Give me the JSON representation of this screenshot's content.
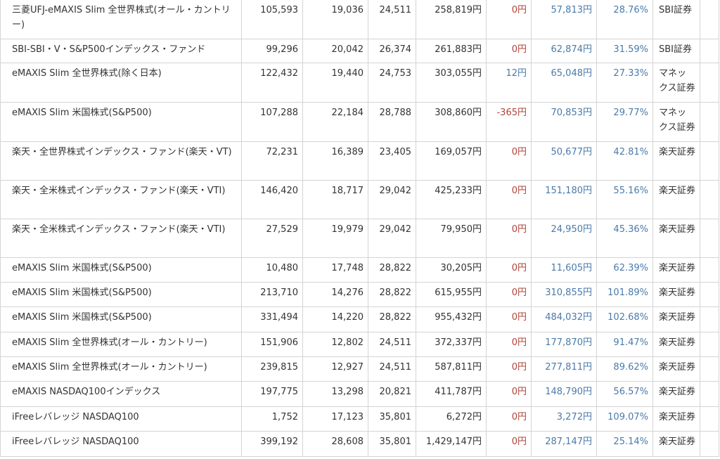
{
  "colors": {
    "zero_fee": "#b0443a",
    "positive_fee": "#4a7aaa",
    "gain": "#4a7aaa",
    "border": "#d4d4d4",
    "text": "#333333"
  },
  "rows": [
    {
      "name": "三菱UFJ-eMAXIS Slim 全世界株式(オール・カントリー)",
      "units": "105,593",
      "purchase_price": "19,036",
      "current_price": "24,511",
      "valuation": "258,819円",
      "fee": "0円",
      "fee_type": "zero",
      "gain": "57,813円",
      "rate": "28.76%",
      "broker": "SBI証券"
    },
    {
      "name": "SBI-SBI・V・S&P500インデックス・ファンド",
      "units": "99,296",
      "purchase_price": "20,042",
      "current_price": "26,374",
      "valuation": "261,883円",
      "fee": "0円",
      "fee_type": "zero",
      "gain": "62,874円",
      "rate": "31.59%",
      "broker": "SBI証券"
    },
    {
      "name": "eMAXIS Slim 全世界株式(除く日本)",
      "units": "122,432",
      "purchase_price": "19,440",
      "current_price": "24,753",
      "valuation": "303,055円",
      "fee": "12円",
      "fee_type": "pos",
      "gain": "65,048円",
      "rate": "27.33%",
      "broker": "マネックス証券"
    },
    {
      "name": "eMAXIS Slim 米国株式(S&P500)",
      "units": "107,288",
      "purchase_price": "22,184",
      "current_price": "28,788",
      "valuation": "308,860円",
      "fee": "-365円",
      "fee_type": "neg",
      "gain": "70,853円",
      "rate": "29.77%",
      "broker": "マネックス証券"
    },
    {
      "name": "楽天・全世界株式インデックス・ファンド(楽天・VT)",
      "units": "72,231",
      "purchase_price": "16,389",
      "current_price": "23,405",
      "valuation": "169,057円",
      "fee": "0円",
      "fee_type": "zero",
      "gain": "50,677円",
      "rate": "42.81%",
      "broker": "楽天証券"
    },
    {
      "name": "楽天・全米株式インデックス・ファンド(楽天・VTI)",
      "units": "146,420",
      "purchase_price": "18,717",
      "current_price": "29,042",
      "valuation": "425,233円",
      "fee": "0円",
      "fee_type": "zero",
      "gain": "151,180円",
      "rate": "55.16%",
      "broker": "楽天証券"
    },
    {
      "name": "楽天・全米株式インデックス・ファンド(楽天・VTI)",
      "units": "27,529",
      "purchase_price": "19,979",
      "current_price": "29,042",
      "valuation": "79,950円",
      "fee": "0円",
      "fee_type": "zero",
      "gain": "24,950円",
      "rate": "45.36%",
      "broker": "楽天証券"
    },
    {
      "name": "eMAXIS Slim 米国株式(S&P500)",
      "units": "10,480",
      "purchase_price": "17,748",
      "current_price": "28,822",
      "valuation": "30,205円",
      "fee": "0円",
      "fee_type": "zero",
      "gain": "11,605円",
      "rate": "62.39%",
      "broker": "楽天証券"
    },
    {
      "name": "eMAXIS Slim 米国株式(S&P500)",
      "units": "213,710",
      "purchase_price": "14,276",
      "current_price": "28,822",
      "valuation": "615,955円",
      "fee": "0円",
      "fee_type": "zero",
      "gain": "310,855円",
      "rate": "101.89%",
      "broker": "楽天証券"
    },
    {
      "name": "eMAXIS Slim 米国株式(S&P500)",
      "units": "331,494",
      "purchase_price": "14,220",
      "current_price": "28,822",
      "valuation": "955,432円",
      "fee": "0円",
      "fee_type": "zero",
      "gain": "484,032円",
      "rate": "102.68%",
      "broker": "楽天証券"
    },
    {
      "name": "eMAXIS Slim 全世界株式(オール・カントリー)",
      "units": "151,906",
      "purchase_price": "12,802",
      "current_price": "24,511",
      "valuation": "372,337円",
      "fee": "0円",
      "fee_type": "zero",
      "gain": "177,870円",
      "rate": "91.47%",
      "broker": "楽天証券"
    },
    {
      "name": "eMAXIS Slim 全世界株式(オール・カントリー)",
      "units": "239,815",
      "purchase_price": "12,927",
      "current_price": "24,511",
      "valuation": "587,811円",
      "fee": "0円",
      "fee_type": "zero",
      "gain": "277,811円",
      "rate": "89.62%",
      "broker": "楽天証券"
    },
    {
      "name": "eMAXIS NASDAQ100インデックス",
      "units": "197,775",
      "purchase_price": "13,298",
      "current_price": "20,821",
      "valuation": "411,787円",
      "fee": "0円",
      "fee_type": "zero",
      "gain": "148,790円",
      "rate": "56.57%",
      "broker": "楽天証券"
    },
    {
      "name": "iFreeレバレッジ NASDAQ100",
      "units": "1,752",
      "purchase_price": "17,123",
      "current_price": "35,801",
      "valuation": "6,272円",
      "fee": "0円",
      "fee_type": "zero",
      "gain": "3,272円",
      "rate": "109.07%",
      "broker": "楽天証券"
    },
    {
      "name": "iFreeレバレッジ NASDAQ100",
      "units": "399,192",
      "purchase_price": "28,608",
      "current_price": "35,801",
      "valuation": "1,429,147円",
      "fee": "0円",
      "fee_type": "zero",
      "gain": "287,147円",
      "rate": "25.14%",
      "broker": "楽天証券"
    }
  ]
}
